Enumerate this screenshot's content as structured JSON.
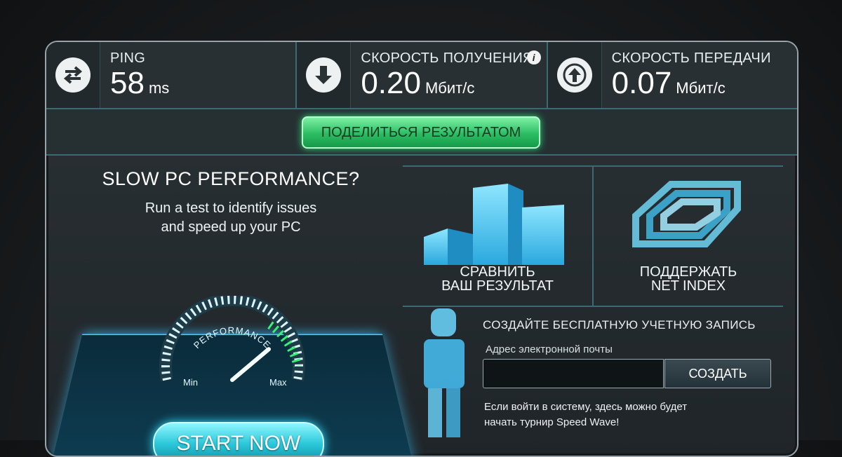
{
  "stats": {
    "ping": {
      "label": "PING",
      "value": "58",
      "unit": "ms",
      "icon": "swap-arrows-icon"
    },
    "download": {
      "label": "СКОРОСТЬ ПОЛУЧЕНИЯ",
      "value": "0.20",
      "unit": "Мбит/с",
      "icon": "download-arrow-icon",
      "info": "i"
    },
    "upload": {
      "label": "СКОРОСТЬ ПЕРЕДАЧИ",
      "value": "0.07",
      "unit": "Мбит/с",
      "icon": "upload-arrow-icon"
    }
  },
  "share_button": "ПОДЕЛИТЬСЯ РЕЗУЛЬТАТОМ",
  "ad": {
    "title": "SLOW PC PERFORMANCE?",
    "subtitle_line1": "Run a test to identify issues",
    "subtitle_line2": "and speed up your PC",
    "gauge_title": "PERFORMANCE",
    "gauge_min": "Min",
    "gauge_max": "Max",
    "gauge_level": 0.82,
    "start_button": "START NOW"
  },
  "tiles": {
    "compare_line1": "СРАВНИТЬ",
    "compare_line2": "ВАШ РЕЗУЛЬТАТ",
    "support_line1": "ПОДДЕРЖАТЬ",
    "support_line2": "NET INDEX"
  },
  "signup": {
    "title": "СОЗДАЙТЕ БЕСПЛАТНУЮ УЧЕТНУЮ ЗАПИСЬ",
    "email_label": "Адрес электронной почты",
    "email_value": "",
    "create_button": "СОЗДАТЬ",
    "note": "Если войти в систему, здесь можно будет начать турнир Speed Wave!"
  },
  "colors": {
    "accent": "#3fd0ff",
    "share_green": "#2bbd63",
    "border": "#3b6a73"
  }
}
